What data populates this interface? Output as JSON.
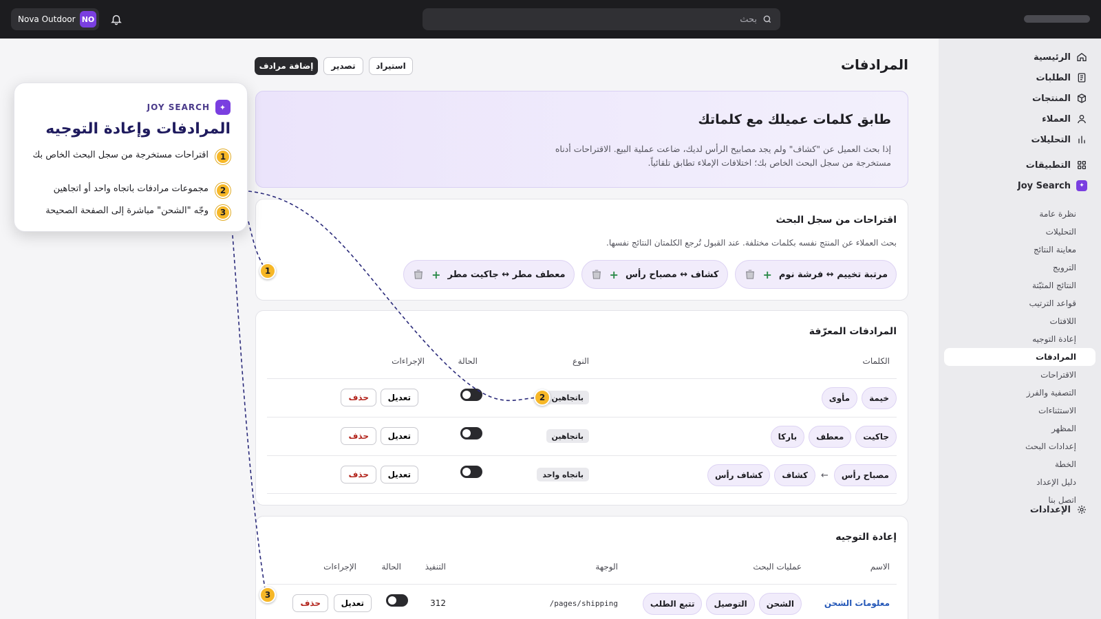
{
  "topbar": {
    "store_name": "Nova Outdoor",
    "store_initials": "NO",
    "search_placeholder": "بحث"
  },
  "sidebar": {
    "main_items": [
      {
        "label": "الرئيسية",
        "icon": "home-icon"
      },
      {
        "label": "الطلبات",
        "icon": "orders-icon"
      },
      {
        "label": "المنتجات",
        "icon": "box-icon"
      },
      {
        "label": "العملاء",
        "icon": "user-icon"
      },
      {
        "label": "التحليلات",
        "icon": "bar-chart-icon"
      }
    ],
    "apps_label": "التطبيقات",
    "app_name": "Joy Search",
    "sub_items": [
      "نظرة عامة",
      "التحليلات",
      "معاينة النتائج",
      "الترويج",
      "النتائج المثبّتة",
      "قواعد الترتيب",
      "اللافتات",
      "إعادة التوجيه",
      "المرادفات",
      "الاقتراحات",
      "التصفية والفرز",
      "الاستثناءات",
      "المظهر",
      "إعدادات البحث",
      "الخطة",
      "دليل الإعداد",
      "اتصل بنا"
    ],
    "active_sub": "المرادفات",
    "settings_label": "الإعدادات"
  },
  "page": {
    "title": "المرادفات",
    "buttons": {
      "import": "استيراد",
      "export": "تصدير",
      "add": "إضافة مرادف"
    }
  },
  "hero": {
    "title": "طابق كلمات عميلك مع كلماتك",
    "text": "إذا بحث العميل عن \"كشاف\" ولم يجد مصابيح الرأس لديك، ضاعت عملية البيع. الاقتراحات أدناه مستخرجة من سجل البحث الخاص بك؛ اختلافات الإملاء تطابق تلقائياً."
  },
  "suggestions": {
    "title": "اقتراحات من سجل البحث",
    "subtitle": "بحث العملاء عن المنتج نفسه بكلمات مختلفة. عند القبول تُرجع الكلمتان النتائج نفسها.",
    "items": [
      "مرتبة تخييم ↔ فرشة نوم",
      "كشاف ↔ مصباح رأس",
      "معطف مطر ↔ جاكيت مطر"
    ]
  },
  "synonyms": {
    "title": "المرادفات المعرّفة",
    "headers": {
      "words": "الكلمات",
      "type": "النوع",
      "status": "الحالة",
      "actions": "الإجراءات"
    },
    "rows": [
      {
        "words": [
          "خيمة",
          "مأوى"
        ],
        "type": "باتجاهين"
      },
      {
        "words": [
          "جاكيت",
          "معطف",
          "باركا"
        ],
        "type": "باتجاهين"
      },
      {
        "source": "مصباح رأس",
        "targets": [
          "كشاف",
          "كشاف رأس"
        ],
        "type": "باتجاه واحد"
      }
    ],
    "edit_label": "تعديل",
    "delete_label": "حذف"
  },
  "redirects": {
    "title": "إعادة التوجيه",
    "headers": {
      "name": "الاسم",
      "searches": "عمليات البحث",
      "destination": "الوجهة",
      "hits": "التنفيذ",
      "status": "الحالة",
      "actions": "الإجراءات"
    },
    "rows": [
      {
        "name": "معلومات الشحن",
        "searches": [
          "الشحن",
          "التوصيل",
          "تتبع الطلب"
        ],
        "destination": "/pages/shipping",
        "hits": "312"
      }
    ],
    "edit_label": "تعديل",
    "delete_label": "حذف"
  },
  "callout": {
    "brand": "JOY SEARCH",
    "title": "المرادفات وإعادة التوجيه",
    "steps": [
      {
        "num": "1",
        "text": "اقتراحات مستخرجة من سجل البحث الخاص بك"
      },
      {
        "num": "2",
        "text": "مجموعات مرادفات باتجاه واحد أو اتجاهين"
      },
      {
        "num": "3",
        "text": "وجّه \"الشحن\" مباشرة إلى الصفحة الصحيحة"
      }
    ]
  },
  "colors": {
    "accent": "#7a3fe0",
    "marker": "#f6b727",
    "dark": "#1c1c1f",
    "danger": "#b3261e",
    "link": "#2558b8"
  }
}
